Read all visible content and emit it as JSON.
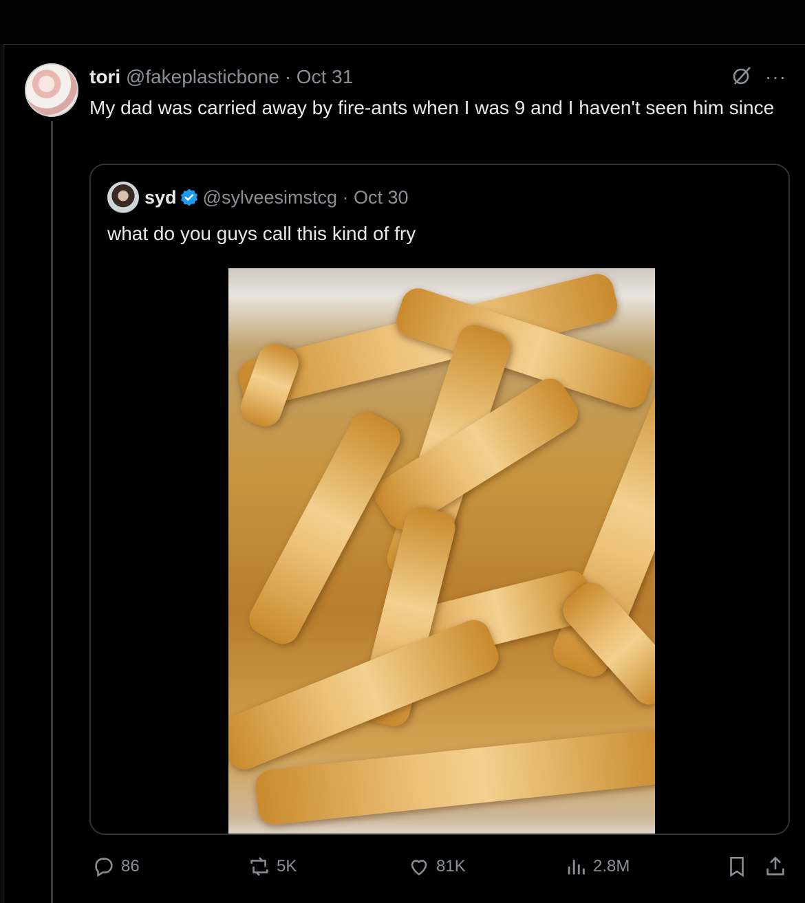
{
  "tweet": {
    "display_name": "tori",
    "handle": "@fakeplasticbone",
    "separator": "·",
    "date": "Oct 31",
    "text": "My dad was carried away by fire-ants when I was 9 and I haven't seen him since",
    "more_label": "···"
  },
  "quoted_tweet": {
    "display_name": "syd",
    "handle": "@sylveesimstcg",
    "separator": "·",
    "date": "Oct 30",
    "text": "what do you guys call this kind of fry",
    "verified": true
  },
  "actions": {
    "replies": "86",
    "reposts": "5K",
    "likes": "81K",
    "views": "2.8M"
  },
  "colors": {
    "background": "#000000",
    "text": "#e7e9ea",
    "muted": "#8b9097",
    "verified_blue": "#1d9bf0",
    "border": "#2f3336"
  },
  "icons": [
    "grok-icon",
    "more-icon",
    "verified-badge-icon",
    "reply-icon",
    "repost-icon",
    "like-icon",
    "views-icon",
    "bookmark-icon",
    "share-icon"
  ]
}
